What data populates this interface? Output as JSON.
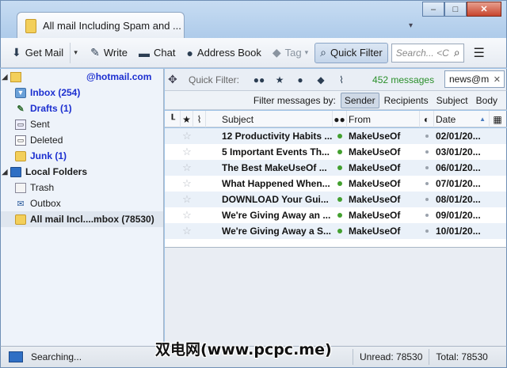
{
  "window": {
    "tab_title": "All mail Including Spam and ...",
    "tab_menu": "▾",
    "min_label": "–",
    "max_label": "□",
    "close_label": "✕"
  },
  "toolbar": {
    "get_mail": "Get Mail",
    "get_mail_dropdown": "▾",
    "write": "Write",
    "chat": "Chat",
    "address_book": "Address Book",
    "tag": "Tag",
    "tag_dropdown": "▾",
    "quick_filter": "Quick Filter",
    "search_placeholder": "Search... <C",
    "menu": "☰"
  },
  "folders": {
    "account": "@hotmail.com",
    "items": [
      {
        "label": "Inbox (254)"
      },
      {
        "label": "Drafts (1)"
      },
      {
        "label": "Sent"
      },
      {
        "label": "Deleted"
      },
      {
        "label": "Junk (1)"
      }
    ],
    "local_folders": "Local Folders",
    "local_items": [
      {
        "label": "Trash"
      },
      {
        "label": "Outbox"
      },
      {
        "label": "All mail Incl....mbox (78530)"
      }
    ],
    "twisty_open": "◢"
  },
  "quick_filter": {
    "label": "Quick Filter:",
    "message_count": "452 messages",
    "input_value": "news@m",
    "clear": "✕"
  },
  "filter_by": {
    "label": "Filter messages by:",
    "options": [
      "Sender",
      "Recipients",
      "Subject",
      "Body"
    ]
  },
  "columns": {
    "subject": "Subject",
    "from": "From",
    "date": "Date",
    "sort_indicator": "▲"
  },
  "messages": [
    {
      "subject": "12 Productivity Habits ...",
      "from": "MakeUseOf",
      "date": "02/01/20..."
    },
    {
      "subject": "5 Important Events Th...",
      "from": "MakeUseOf",
      "date": "03/01/20..."
    },
    {
      "subject": "The Best MakeUseOf ...",
      "from": "MakeUseOf",
      "date": "06/01/20..."
    },
    {
      "subject": "What Happened When...",
      "from": "MakeUseOf",
      "date": "07/01/20..."
    },
    {
      "subject": "DOWNLOAD Your Gui...",
      "from": "MakeUseOf",
      "date": "08/01/20..."
    },
    {
      "subject": "We're Giving Away an ...",
      "from": "MakeUseOf",
      "date": "09/01/20..."
    },
    {
      "subject": "We're Giving Away a S...",
      "from": "MakeUseOf",
      "date": "10/01/20..."
    }
  ],
  "status": {
    "text": "Searching...",
    "unread": "Unread: 78530",
    "total": "Total: 78530"
  },
  "watermark": "双电网(www.pcpc.me)",
  "colors": {
    "accent": "#1c2fd0",
    "count_green": "#2a8f2a",
    "row_alt": "#eaf1f9"
  }
}
